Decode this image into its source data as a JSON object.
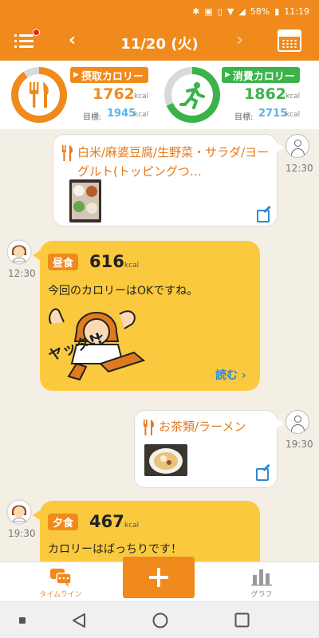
{
  "status_bar": {
    "battery": "58%",
    "time": "11:19"
  },
  "header": {
    "date": "11/20 (火)",
    "prev": "‹",
    "next": "›"
  },
  "summary": {
    "intake": {
      "label": "摂取カロリー",
      "value": "1762",
      "unit": "kcal",
      "goal_label": "目標:",
      "goal": "1945",
      "goal_unit": "kcal",
      "progress": 0.906,
      "color": "#f08a1c"
    },
    "burn": {
      "label": "消費カロリー",
      "value": "1862",
      "unit": "kcal",
      "goal_label": "目標:",
      "goal": "2715",
      "goal_unit": "kcal",
      "progress": 0.686,
      "color": "#3cb24a"
    }
  },
  "timeline": {
    "entries": [
      {
        "type": "user-meal",
        "text": "白米/麻婆豆腐/生野菜・サラダ/ヨーグルト(トッピングつ…",
        "time": "12:30",
        "photo": "lunch-tray-photo",
        "edit_icon": "edit-icon"
      },
      {
        "type": "coach",
        "time": "12:30",
        "meal": "昼食",
        "kcal": "616",
        "unit": "kcal",
        "message": "今回のカロリーはOKですね。",
        "illustration": "cheering-girl",
        "illustration_text": "ヤッタ!!",
        "read_more": "読む ›"
      },
      {
        "type": "user-meal",
        "text": "お茶類/ラーメン",
        "time": "19:30",
        "photo": "ramen-photo",
        "edit_icon": "edit-icon"
      },
      {
        "type": "coach",
        "time": "19:30",
        "meal": "夕食",
        "kcal": "467",
        "unit": "kcal",
        "message": "カロリーはばっちりです！"
      }
    ]
  },
  "bottom_nav": {
    "timeline_label": "タイムライン",
    "graph_label": "グラフ",
    "active_color": "#f08a1c",
    "inactive_color": "#888888"
  }
}
